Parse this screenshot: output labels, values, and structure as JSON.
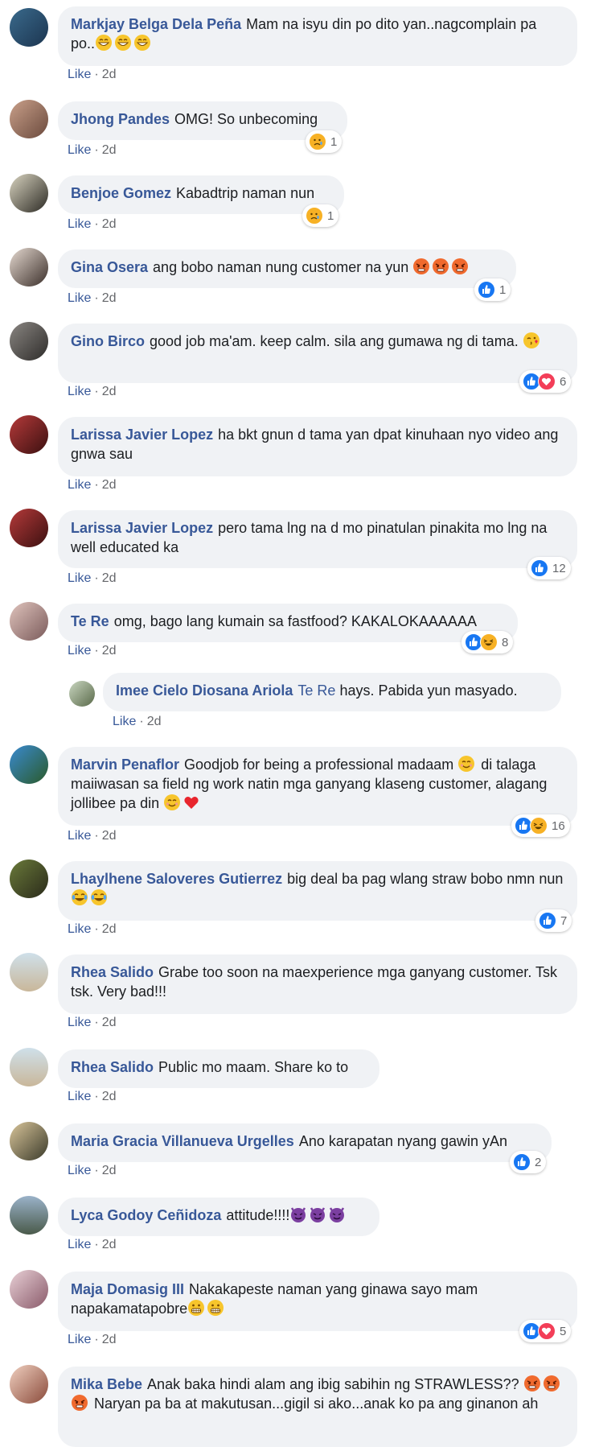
{
  "like_label": "Like",
  "separator": "·",
  "comments": [
    {
      "author": "Markjay Belga Dela Peña",
      "text": "Mam na isyu din po dito yan..nagcomplain pa po..",
      "emoji": [
        "grin",
        "grin",
        "grin"
      ],
      "time": "2d",
      "reaction": null
    },
    {
      "author": "Jhong Pandes",
      "text": "OMG! So unbecoming",
      "emoji": [],
      "time": "2d",
      "reaction": {
        "types": [
          "sad"
        ],
        "count": "1"
      }
    },
    {
      "author": "Benjoe Gomez",
      "text": "Kabadtrip naman nun",
      "emoji": [],
      "time": "2d",
      "reaction": {
        "types": [
          "sad"
        ],
        "count": "1"
      }
    },
    {
      "author": "Gina Osera",
      "text": "ang bobo naman nung customer na yun",
      "emoji": [
        "angry",
        "angry",
        "angry"
      ],
      "time": "2d",
      "reaction": {
        "types": [
          "like"
        ],
        "count": "1"
      }
    },
    {
      "author": "Gino Birco",
      "text": "good job ma'am. keep calm. sila ang gumawa ng di tama.",
      "emoji": [
        "kiss"
      ],
      "time": "2d",
      "reaction": {
        "types": [
          "like",
          "love"
        ],
        "count": "6"
      }
    },
    {
      "author": "Larissa Javier Lopez",
      "text": "ha bkt gnun d tama yan dpat kinuhaan nyo video ang gnwa sau",
      "emoji": [],
      "time": "2d",
      "reaction": null
    },
    {
      "author": "Larissa Javier Lopez",
      "text": "pero tama lng na d mo pinatulan pinakita mo lng na well educated ka",
      "emoji": [],
      "time": "2d",
      "reaction": {
        "types": [
          "like"
        ],
        "count": "12"
      }
    },
    {
      "author": "Te Re",
      "text": "omg, bago lang kumain sa fastfood? KAKALOKAAAAAA",
      "emoji": [],
      "time": "2d",
      "reaction": {
        "types": [
          "like",
          "haha"
        ],
        "count": "8"
      }
    },
    {
      "author": "Imee Cielo Diosana Ariola",
      "mention": "Te Re",
      "text": "hays. Pabida yun masyado.",
      "emoji": [],
      "time": "2d",
      "reaction": null,
      "reply": true
    },
    {
      "author": "Marvin Penaflor",
      "text": "Goodjob for being a professional madaam",
      "text2": "di talaga maiiwasan sa field ng work natin mga ganyang klaseng customer, alagang jollibee pa din",
      "emoji": [
        "smile"
      ],
      "emoji2": [
        "smile",
        "heart"
      ],
      "time": "2d",
      "reaction": {
        "types": [
          "like",
          "haha"
        ],
        "count": "16"
      }
    },
    {
      "author": "Lhaylhene Saloveres Gutierrez",
      "text": "big deal ba pag wlang straw bobo nmn nun",
      "emoji": [
        "joy",
        "joy"
      ],
      "time": "2d",
      "reaction": {
        "types": [
          "like"
        ],
        "count": "7"
      }
    },
    {
      "author": "Rhea Salido",
      "text": "Grabe too soon na maexperience mga ganyang customer. Tsk tsk. Very bad!!!",
      "emoji": [],
      "time": "2d",
      "reaction": null
    },
    {
      "author": "Rhea Salido",
      "text": "Public mo maam. Share ko to",
      "emoji": [],
      "time": "2d",
      "reaction": null
    },
    {
      "author": "Maria Gracia Villanueva Urgelles",
      "text": "Ano karapatan nyang gawin yAn",
      "emoji": [],
      "time": "2d",
      "reaction": {
        "types": [
          "like"
        ],
        "count": "2"
      }
    },
    {
      "author": "Lyca Godoy Ceñidoza",
      "text": "attitude!!!!",
      "emoji": [
        "devil",
        "devil",
        "devil"
      ],
      "time": "2d",
      "reaction": null
    },
    {
      "author": "Maja Domasig III",
      "text": "Nakakapeste naman yang ginawa sayo mam napakamatapobre",
      "emoji": [
        "grimace",
        "grimace"
      ],
      "time": "2d",
      "reaction": {
        "types": [
          "like",
          "love"
        ],
        "count": "5"
      }
    },
    {
      "author": "Mika Bebe",
      "text": "Anak baka hindi alam ang ibig sabihin ng STRAWLESS??",
      "text2": "Naryan pa ba at makutusan...gigil si ako...anak ko pa ang ginanon ah",
      "emoji": [
        "angry",
        "angry",
        "angry"
      ],
      "time": "2d",
      "reaction": null
    }
  ],
  "colors": {
    "link": "#385898",
    "bubble": "#f0f2f5",
    "meta": "#65676b",
    "like_blue": "#1877f2",
    "love_red": "#f33e58"
  }
}
